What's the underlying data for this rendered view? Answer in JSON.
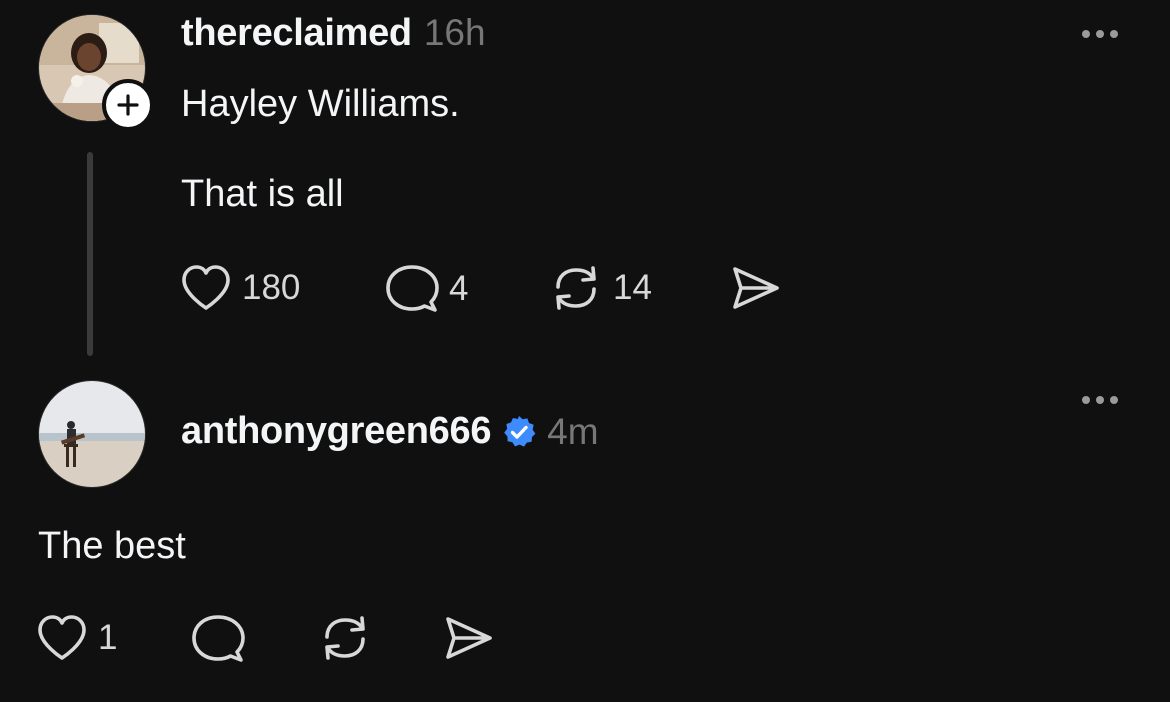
{
  "post": {
    "username": "thereclaimed",
    "time": "16h",
    "lines": [
      "Hayley Williams.",
      "That is all"
    ],
    "avatar_icon": "avatar-photo",
    "follow_icon": "plus-icon",
    "actions": {
      "likes": "180",
      "replies": "4",
      "reposts": "14"
    }
  },
  "reply": {
    "username": "anthonygreen666",
    "verified_icon": "verified-badge-icon",
    "time": "4m",
    "text": "The best",
    "actions": {
      "likes": "1"
    }
  },
  "colors": {
    "background": "#101010",
    "verified": "#3d8bfd",
    "muted": "#777777"
  }
}
